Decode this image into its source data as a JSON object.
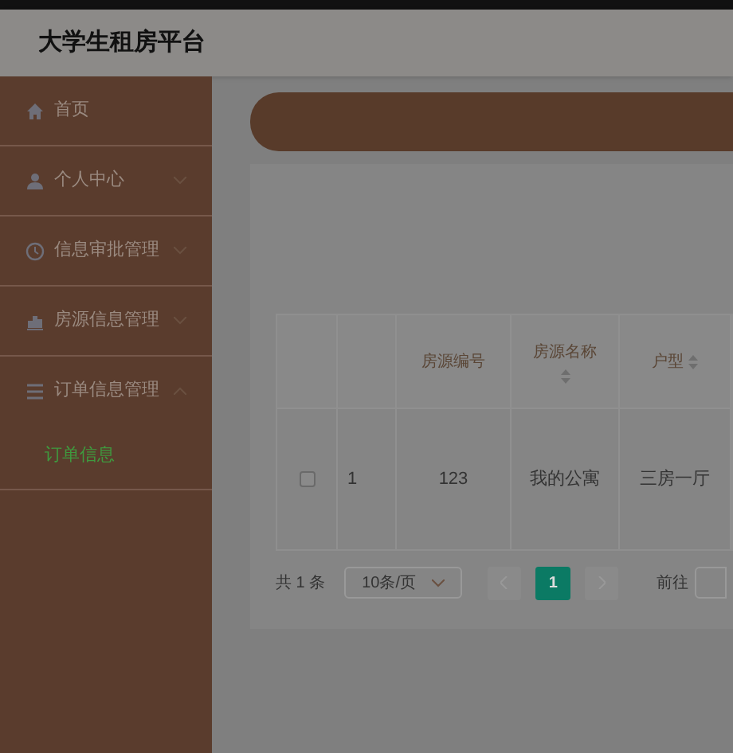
{
  "header": {
    "title": "大学生租房平台"
  },
  "sidebar": {
    "items": [
      {
        "label": "首页",
        "kind": "link",
        "selected": false
      },
      {
        "label": "个人中心",
        "kind": "group",
        "expanded": false,
        "selected": false
      },
      {
        "label": "信息审批管理",
        "kind": "group",
        "expanded": false,
        "selected": false
      },
      {
        "label": "房源信息管理",
        "kind": "group",
        "expanded": false,
        "selected": false
      },
      {
        "label": "订单信息管理",
        "kind": "group",
        "expanded": true,
        "selected": false,
        "children": [
          {
            "label": "订单信息",
            "selected": true
          }
        ]
      }
    ]
  },
  "table": {
    "columns": [
      {
        "label": "房源编号",
        "kind": "text"
      },
      {
        "label": "房源名称",
        "kind": "sort-below"
      },
      {
        "label": "户型",
        "kind": "sort-inline"
      }
    ],
    "rows": [
      {
        "checked": false,
        "index": "1",
        "cells": [
          "123",
          "我的公寓",
          "三房一厅"
        ]
      }
    ]
  },
  "pagination": {
    "total": "共 1 条",
    "page_size": "10条/页",
    "pages": [
      {
        "label": "1",
        "selected": true
      }
    ],
    "goto": "前往"
  }
}
